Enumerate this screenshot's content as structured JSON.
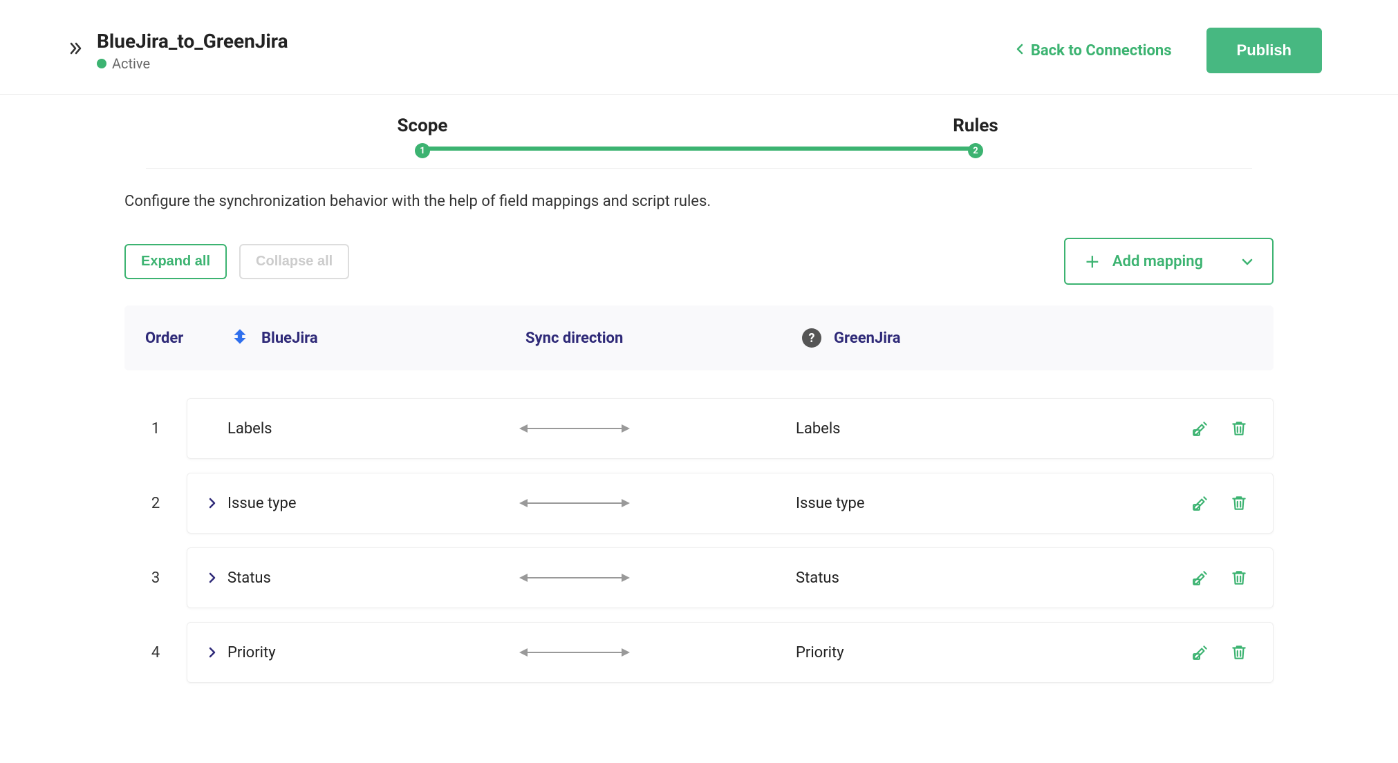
{
  "header": {
    "title": "BlueJira_to_GreenJira",
    "status": "Active",
    "back_label": "Back to Connections",
    "publish_label": "Publish"
  },
  "stepper": {
    "step1_label": "Scope",
    "step1_num": "1",
    "step2_label": "Rules",
    "step2_num": "2"
  },
  "description": "Configure the synchronization behavior with the help of field mappings and script rules.",
  "toolbar": {
    "expand_all": "Expand all",
    "collapse_all": "Collapse all",
    "add_mapping": "Add mapping"
  },
  "columns": {
    "order": "Order",
    "blue": "BlueJira",
    "sync": "Sync direction",
    "green": "GreenJira",
    "help": "?"
  },
  "rows": [
    {
      "order": "1",
      "blue": "Labels",
      "green": "Labels",
      "expandable": false
    },
    {
      "order": "2",
      "blue": "Issue type",
      "green": "Issue type",
      "expandable": true
    },
    {
      "order": "3",
      "blue": "Status",
      "green": "Status",
      "expandable": true
    },
    {
      "order": "4",
      "blue": "Priority",
      "green": "Priority",
      "expandable": true
    }
  ]
}
